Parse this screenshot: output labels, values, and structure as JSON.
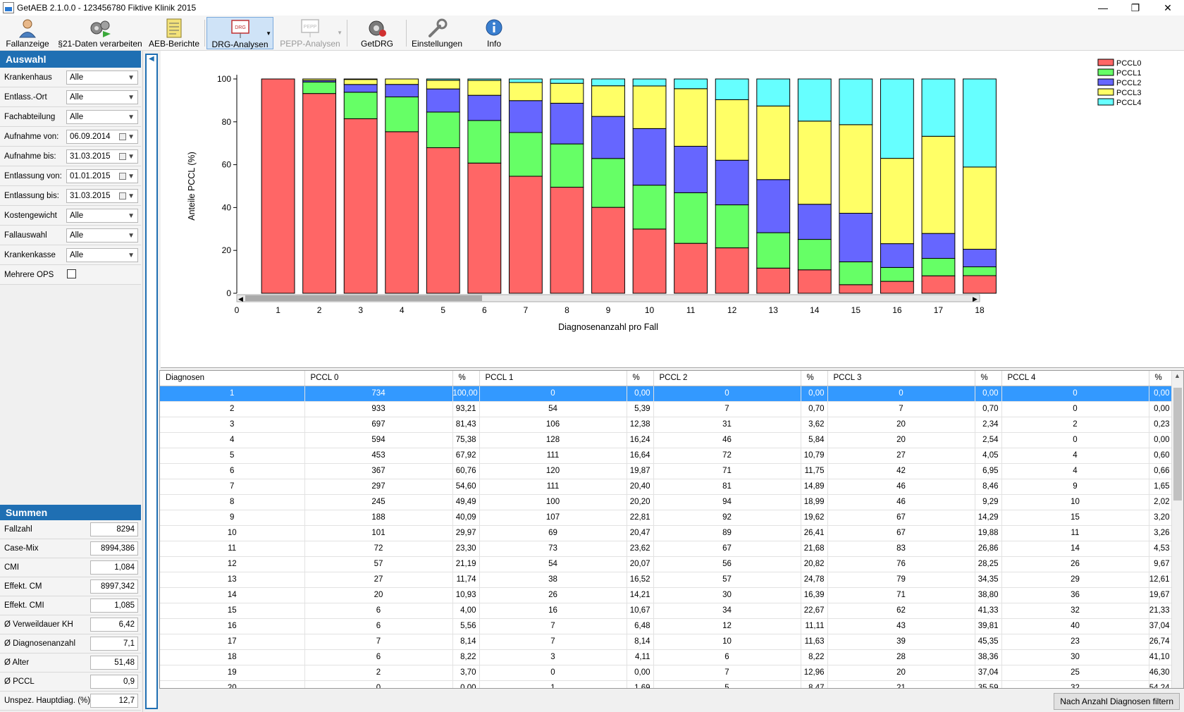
{
  "window": {
    "title": "GetAEB 2.1.0.0 - 123456780 Fiktive Klinik 2015"
  },
  "toolbar": {
    "fallanzeige": "Fallanzeige",
    "daten21": "§21-Daten verarbeiten",
    "aeb": "AEB-Berichte",
    "drg": "DRG-Analysen",
    "pepp": "PEPP-Analysen",
    "getdrg": "GetDRG",
    "einstellungen": "Einstellungen",
    "info": "Info",
    "drg_icon_text": "DRG",
    "pepp_icon_text": "PEPP"
  },
  "auswahl": {
    "header": "Auswahl",
    "filters": [
      {
        "label": "Krankenhaus",
        "value": "Alle"
      },
      {
        "label": "Entlass.-Ort",
        "value": "Alle"
      },
      {
        "label": "Fachabteilung",
        "value": "Alle"
      },
      {
        "label": "Aufnahme von:",
        "value": "06.09.2014"
      },
      {
        "label": "Aufnahme bis:",
        "value": "31.03.2015"
      },
      {
        "label": "Entlassung von:",
        "value": "01.01.2015"
      },
      {
        "label": "Entlassung bis:",
        "value": "31.03.2015"
      },
      {
        "label": "Kostengewicht",
        "value": "Alle"
      },
      {
        "label": "Fallauswahl",
        "value": "Alle"
      },
      {
        "label": "Krankenkasse",
        "value": "Alle"
      }
    ],
    "mehrere_ops": "Mehrere OPS"
  },
  "summen": {
    "header": "Summen",
    "rows": [
      {
        "label": "Fallzahl",
        "value": "8294"
      },
      {
        "label": "Case-Mix",
        "value": "8994,386"
      },
      {
        "label": "CMI",
        "value": "1,084"
      },
      {
        "label": "Effekt. CM",
        "value": "8997,342"
      },
      {
        "label": "Effekt. CMI",
        "value": "1,085"
      },
      {
        "label": "Ø Verweildauer KH",
        "value": "6,42"
      },
      {
        "label": "Ø Diagnosenanzahl",
        "value": "7,1"
      },
      {
        "label": "Ø Alter",
        "value": "51,48"
      },
      {
        "label": "Ø PCCL",
        "value": "0,9"
      },
      {
        "label": "Unspez. Hauptdiag. (%)",
        "value": "12,7"
      }
    ]
  },
  "chart_data": {
    "type": "bar",
    "stacked": true,
    "ylabel": "Anteile PCCL (%)",
    "xlabel": "Diagnosenanzahl pro Fall",
    "ylim": [
      0,
      100
    ],
    "yticks": [
      0,
      20,
      40,
      60,
      80,
      100
    ],
    "xticks": [
      0,
      1,
      2,
      3,
      4,
      5,
      6,
      7,
      8,
      9,
      10,
      11,
      12,
      13,
      14,
      15,
      16,
      17,
      18
    ],
    "legend_position": "top-right",
    "categories": [
      1,
      2,
      3,
      4,
      5,
      6,
      7,
      8,
      9,
      10,
      11,
      12,
      13,
      14,
      15,
      16,
      17,
      18
    ],
    "series": [
      {
        "name": "PCCL0",
        "color": "#ff6666",
        "values": [
          100,
          93.21,
          81.43,
          75.38,
          67.92,
          60.76,
          54.6,
          49.49,
          40.09,
          29.97,
          23.3,
          21.19,
          11.74,
          10.93,
          4.0,
          5.56,
          8.14,
          8.22
        ]
      },
      {
        "name": "PCCL1",
        "color": "#66ff66",
        "values": [
          0,
          5.39,
          12.38,
          16.24,
          16.64,
          19.87,
          20.4,
          20.2,
          22.81,
          20.47,
          23.62,
          20.07,
          16.52,
          14.21,
          10.67,
          6.48,
          8.14,
          4.11
        ]
      },
      {
        "name": "PCCL2",
        "color": "#6666ff",
        "values": [
          0,
          0.7,
          3.62,
          5.84,
          10.79,
          11.75,
          14.89,
          18.99,
          19.62,
          26.41,
          21.68,
          20.82,
          24.78,
          16.39,
          22.67,
          11.11,
          11.63,
          8.22
        ]
      },
      {
        "name": "PCCL3",
        "color": "#ffff66",
        "values": [
          0,
          0.7,
          2.34,
          2.54,
          4.05,
          6.95,
          8.46,
          9.29,
          14.29,
          19.88,
          26.86,
          28.25,
          34.35,
          38.8,
          41.33,
          39.81,
          45.35,
          38.36
        ]
      },
      {
        "name": "PCCL4",
        "color": "#66ffff",
        "values": [
          0,
          0,
          0.23,
          0,
          0.6,
          0.66,
          1.65,
          2.02,
          3.2,
          3.26,
          4.53,
          9.67,
          12.61,
          19.67,
          21.33,
          37.04,
          26.74,
          41.1
        ]
      }
    ]
  },
  "table": {
    "headers": [
      "Diagnosen",
      "PCCL 0",
      "%",
      "PCCL 1",
      "%",
      "PCCL 2",
      "%",
      "PCCL 3",
      "%",
      "PCCL 4",
      "%"
    ],
    "rows": [
      [
        "1",
        "734",
        "100,00",
        "0",
        "0,00",
        "0",
        "0,00",
        "0",
        "0,00",
        "0",
        "0,00"
      ],
      [
        "2",
        "933",
        "93,21",
        "54",
        "5,39",
        "7",
        "0,70",
        "7",
        "0,70",
        "0",
        "0,00"
      ],
      [
        "3",
        "697",
        "81,43",
        "106",
        "12,38",
        "31",
        "3,62",
        "20",
        "2,34",
        "2",
        "0,23"
      ],
      [
        "4",
        "594",
        "75,38",
        "128",
        "16,24",
        "46",
        "5,84",
        "20",
        "2,54",
        "0",
        "0,00"
      ],
      [
        "5",
        "453",
        "67,92",
        "111",
        "16,64",
        "72",
        "10,79",
        "27",
        "4,05",
        "4",
        "0,60"
      ],
      [
        "6",
        "367",
        "60,76",
        "120",
        "19,87",
        "71",
        "11,75",
        "42",
        "6,95",
        "4",
        "0,66"
      ],
      [
        "7",
        "297",
        "54,60",
        "111",
        "20,40",
        "81",
        "14,89",
        "46",
        "8,46",
        "9",
        "1,65"
      ],
      [
        "8",
        "245",
        "49,49",
        "100",
        "20,20",
        "94",
        "18,99",
        "46",
        "9,29",
        "10",
        "2,02"
      ],
      [
        "9",
        "188",
        "40,09",
        "107",
        "22,81",
        "92",
        "19,62",
        "67",
        "14,29",
        "15",
        "3,20"
      ],
      [
        "10",
        "101",
        "29,97",
        "69",
        "20,47",
        "89",
        "26,41",
        "67",
        "19,88",
        "11",
        "3,26"
      ],
      [
        "11",
        "72",
        "23,30",
        "73",
        "23,62",
        "67",
        "21,68",
        "83",
        "26,86",
        "14",
        "4,53"
      ],
      [
        "12",
        "57",
        "21,19",
        "54",
        "20,07",
        "56",
        "20,82",
        "76",
        "28,25",
        "26",
        "9,67"
      ],
      [
        "13",
        "27",
        "11,74",
        "38",
        "16,52",
        "57",
        "24,78",
        "79",
        "34,35",
        "29",
        "12,61"
      ],
      [
        "14",
        "20",
        "10,93",
        "26",
        "14,21",
        "30",
        "16,39",
        "71",
        "38,80",
        "36",
        "19,67"
      ],
      [
        "15",
        "6",
        "4,00",
        "16",
        "10,67",
        "34",
        "22,67",
        "62",
        "41,33",
        "32",
        "21,33"
      ],
      [
        "16",
        "6",
        "5,56",
        "7",
        "6,48",
        "12",
        "11,11",
        "43",
        "39,81",
        "40",
        "37,04"
      ],
      [
        "17",
        "7",
        "8,14",
        "7",
        "8,14",
        "10",
        "11,63",
        "39",
        "45,35",
        "23",
        "26,74"
      ],
      [
        "18",
        "6",
        "8,22",
        "3",
        "4,11",
        "6",
        "8,22",
        "28",
        "38,36",
        "30",
        "41,10"
      ],
      [
        "19",
        "2",
        "3,70",
        "0",
        "0,00",
        "7",
        "12,96",
        "20",
        "37,04",
        "25",
        "46,30"
      ],
      [
        "20",
        "0",
        "0,00",
        "1",
        "1,69",
        "5",
        "8,47",
        "21",
        "35,59",
        "32",
        "54,24"
      ]
    ]
  },
  "status": {
    "filter_button": "Nach Anzahl Diagnosen filtern"
  }
}
